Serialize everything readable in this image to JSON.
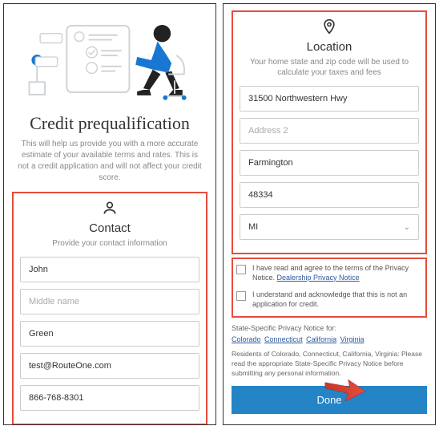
{
  "left": {
    "heading": "Credit prequalification",
    "subtext": "This will help us provide you with a more accurate estimate of your available terms and rates. This is not a credit application and will not affect your credit score.",
    "contact": {
      "title": "Contact",
      "subtitle": "Provide your contact information",
      "first_name": "John",
      "middle_name_placeholder": "Middle name",
      "last_name": "Green",
      "email": "test@RouteOne.com",
      "phone": "866-768-8301"
    }
  },
  "right": {
    "location": {
      "title": "Location",
      "subtitle": "Your home state and zip code will be used to calculate your taxes and fees",
      "address1": "31500 Northwestern Hwy",
      "address2_placeholder": "Address 2",
      "city": "Farmington",
      "zip": "48334",
      "state": "MI"
    },
    "consent": {
      "privacy_text": "I have read and agree to the terms of the Privacy Notice.",
      "privacy_link": "Dealership Privacy Notice",
      "credit_text": "I understand and acknowledge that this is not an application for credit."
    },
    "state_notice": "State-Specific Privacy Notice for:",
    "state_links": [
      "Colorado",
      "Connecticut",
      "California",
      "Virginia"
    ],
    "residents": "Residents of Colorado, Connecticut, California, Virginia: Please read the appropriate State-Specific Privacy Notice before submitting any personal information.",
    "done": "Done"
  }
}
